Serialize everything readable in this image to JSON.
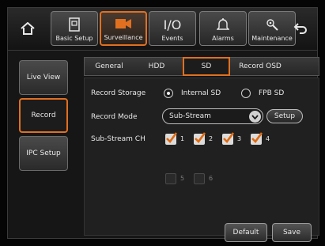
{
  "top_tabs": [
    {
      "label": "Basic Setup",
      "icon": "basic-setup-icon",
      "active": false
    },
    {
      "label": "Surveillance",
      "icon": "camera-icon",
      "active": true
    },
    {
      "label": "Events",
      "icon": "io-icon",
      "icon_text": "I/O",
      "active": false
    },
    {
      "label": "Alarms",
      "icon": "bell-icon",
      "active": false
    },
    {
      "label": "Maintenance",
      "icon": "wrench-gear-icon",
      "active": false
    }
  ],
  "side_nav": [
    {
      "label": "Live View",
      "active": false
    },
    {
      "label": "Record",
      "active": true
    },
    {
      "label": "IPC Setup",
      "active": false
    }
  ],
  "sub_tabs": [
    {
      "label": "General",
      "active": false
    },
    {
      "label": "HDD",
      "active": false
    },
    {
      "label": "SD",
      "active": true
    },
    {
      "label": "Record OSD",
      "active": false
    }
  ],
  "form": {
    "record_storage_label": "Record Storage",
    "record_storage_options": [
      "Internal SD",
      "FPB SD"
    ],
    "record_storage_selected": "Internal SD",
    "record_mode_label": "Record Mode",
    "record_mode_value": "Sub-Stream",
    "setup_label": "Setup",
    "sub_stream_label": "Sub-Stream CH",
    "channels": [
      {
        "num": "1",
        "checked": true,
        "enabled": true
      },
      {
        "num": "2",
        "checked": true,
        "enabled": true
      },
      {
        "num": "3",
        "checked": true,
        "enabled": true
      },
      {
        "num": "4",
        "checked": true,
        "enabled": true
      },
      {
        "num": "5",
        "checked": false,
        "enabled": false
      },
      {
        "num": "6",
        "checked": false,
        "enabled": false
      }
    ]
  },
  "footer": {
    "default_label": "Default",
    "save_label": "Save"
  },
  "colors": {
    "accent": "#e07020",
    "check": "#e06a10"
  }
}
